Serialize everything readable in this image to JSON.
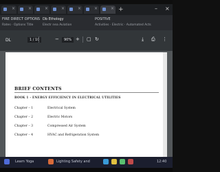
{
  "browser": {
    "tabs": [
      {
        "active": false
      },
      {
        "active": false
      },
      {
        "active": false
      },
      {
        "active": false
      },
      {
        "active": false
      },
      {
        "active": false
      },
      {
        "active": true
      },
      {
        "active": false
      }
    ],
    "new_tab_symbol": "+",
    "window_controls": {
      "min": "–",
      "close": "×"
    },
    "nav": {
      "left_text": "FIRE DIRECT OPTIONS",
      "mid_text": "Db Ethology",
      "right_text": "POSITIVE",
      "row2_left": "Rates  ·  Options Title",
      "row2_mid": "Electr nea Aviation",
      "row2_right": "Activities  ·  Electric  ·  Automated Acts"
    }
  },
  "pdf_toolbar": {
    "title": "DL",
    "page_indicator": "1 / 10",
    "zoom": "90%",
    "icons": [
      "minus-icon",
      "plus-icon",
      "fit-icon",
      "rotate-icon",
      "download-icon",
      "print-icon",
      "more-icon"
    ]
  },
  "document": {
    "heading": "BRIEF CONTENTS",
    "book_line": "BOOK 1 - ENERGY EFFICIENCY IN ELECTRICAL UTILITIES",
    "chapters": [
      {
        "label": "Chapter – 1",
        "name": "Electrical System"
      },
      {
        "label": "Chapter – 2",
        "name": "Electric Motors"
      },
      {
        "label": "Chapter – 3",
        "name": "Compressed Air System"
      },
      {
        "label": "Chapter – 4",
        "name": "HVAC and Refrigeration System"
      }
    ]
  },
  "taskbar": {
    "item1": "Learn Yoga",
    "item2": "Lighting Safety and",
    "clock": "12:40"
  },
  "colors": {
    "toolbar_bg": "#323639",
    "viewer_bg": "#525659",
    "page_bg": "#ffffff",
    "taskbar_bg": "#1b1e2e"
  }
}
